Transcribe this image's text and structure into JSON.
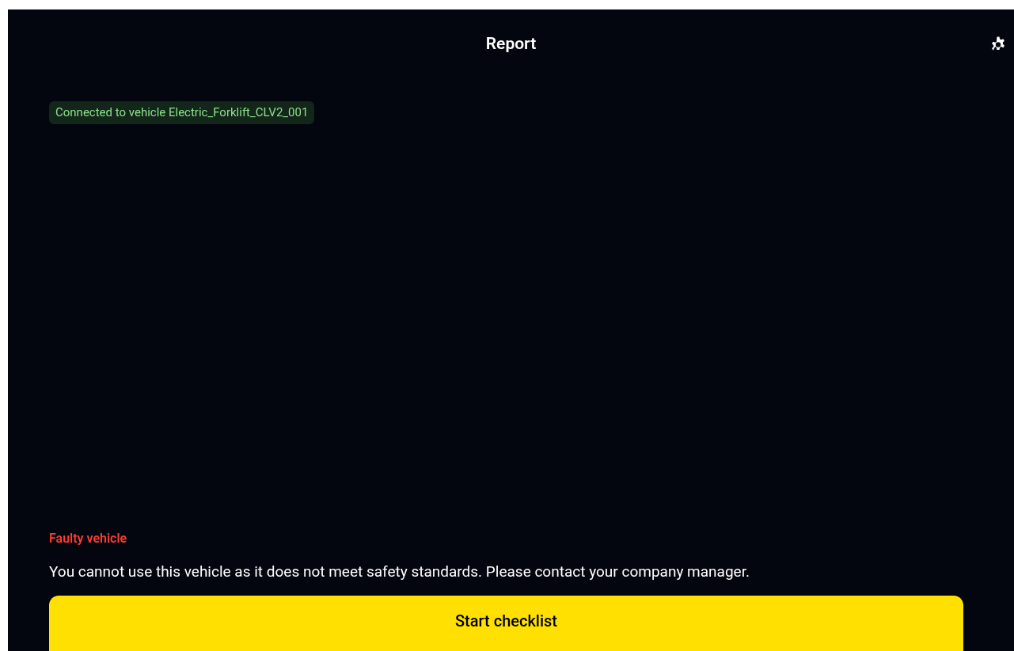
{
  "header": {
    "title": "Report"
  },
  "connection": {
    "text": "Connected to vehicle Electric_Forklift_CLV2_001"
  },
  "alert": {
    "title": "Faulty vehicle",
    "message": "You cannot use this vehicle as it does not meet safety standards. Please contact your company manager."
  },
  "primary_button": {
    "label": "Start checklist"
  }
}
